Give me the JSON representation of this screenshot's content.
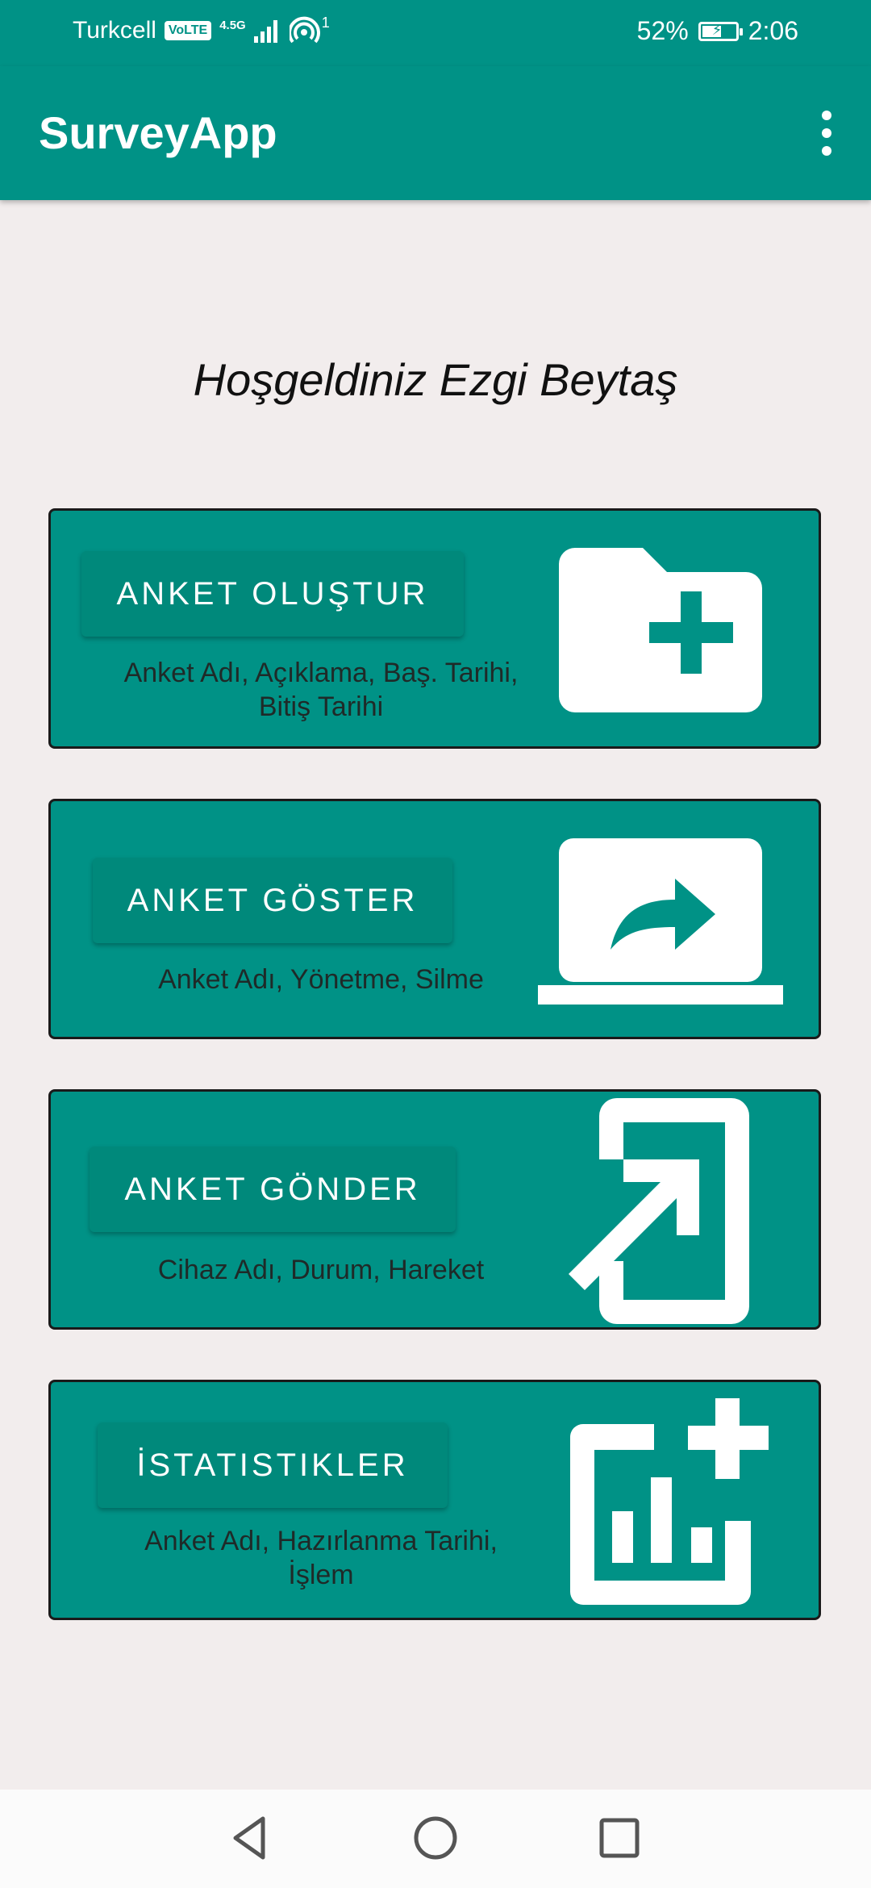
{
  "status_bar": {
    "carrier": "Turkcell",
    "volte": "VoLTE",
    "network": "4.5G",
    "hotspot_count": "1",
    "battery_percent": "52%",
    "battery_level": 0.52,
    "time": "2:06"
  },
  "app_bar": {
    "title": "SurveyApp",
    "overflow_icon": "more-vert-icon"
  },
  "welcome_text": "Hoşgeldiniz Ezgi Beytaş",
  "cards": [
    {
      "button_label": "ANKET OLUŞTUR",
      "description_line1": "Anket Adı, Açıklama, Baş. Tarihi,",
      "description_line2": "Bitiş Tarihi",
      "icon": "create-folder-icon"
    },
    {
      "button_label": "ANKET GÖSTER",
      "description_line1": "Anket Adı, Yönetme, Silme",
      "icon": "screen-share-icon"
    },
    {
      "button_label": "ANKET GÖNDER",
      "description_line1": "Cihaz Adı, Durum, Hareket",
      "icon": "send-to-mobile-icon"
    },
    {
      "button_label": "İSTATISTIKLER",
      "description_line1": "Anket Adı, Hazırlanma Tarihi,",
      "description_line2": "İşlem",
      "icon": "add-chart-icon"
    }
  ],
  "nav_bar": {
    "back_icon": "back-triangle-icon",
    "home_icon": "home-circle-icon",
    "recents_icon": "recents-square-icon"
  },
  "colors": {
    "primary": "#009286",
    "button": "#00897b",
    "background": "#f2eded"
  }
}
